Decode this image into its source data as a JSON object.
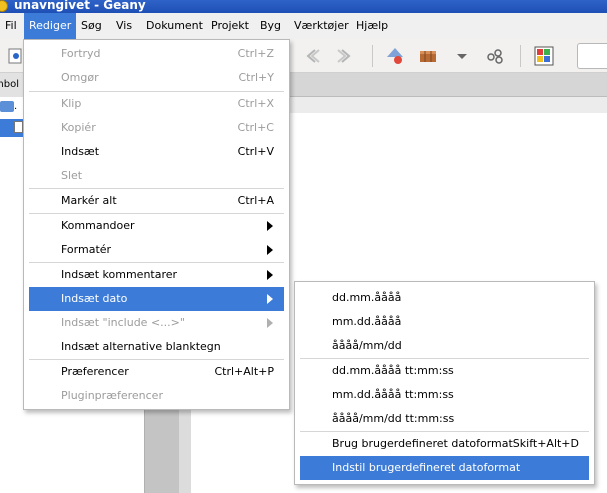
{
  "window": {
    "title": "unavngivet - Geany"
  },
  "menubar": [
    "Fil",
    "Rediger",
    "Søg",
    "Vis",
    "Dokument",
    "Projekt",
    "Byg",
    "Værktøjer",
    "Hjælp"
  ],
  "sidebar": {
    "tab_label": "mbol",
    "tree_label": "."
  },
  "colors": {
    "selection": "#3c7cd8",
    "disabled_text": "#9c9c9c",
    "titlebar": "#1e4fb5"
  },
  "rediger_menu": {
    "items": [
      {
        "label": "Fortryd",
        "accel": "Ctrl+Z",
        "disabled": true
      },
      {
        "label": "Omgør",
        "accel": "Ctrl+Y",
        "disabled": true
      },
      {
        "label": "Klip",
        "accel": "Ctrl+X",
        "disabled": true
      },
      {
        "label": "Kopiér",
        "accel": "Ctrl+C",
        "disabled": true
      },
      {
        "label": "Indsæt",
        "accel": "Ctrl+V",
        "disabled": false
      },
      {
        "label": "Slet",
        "accel": "",
        "disabled": true
      },
      {
        "label": "Markér alt",
        "accel": "Ctrl+A",
        "disabled": false
      },
      {
        "label": "Kommandoer",
        "accel": "",
        "disabled": false,
        "submenu": true
      },
      {
        "label": "Formatér",
        "accel": "",
        "disabled": false,
        "submenu": true
      },
      {
        "label": "Indsæt kommentarer",
        "accel": "",
        "disabled": false,
        "submenu": true
      },
      {
        "label": "Indsæt dato",
        "accel": "",
        "disabled": false,
        "submenu": true,
        "selected": true
      },
      {
        "label": "Indsæt \"include <...>\"",
        "accel": "",
        "disabled": true,
        "submenu": true
      },
      {
        "label": "Indsæt alternative blanktegn",
        "accel": "",
        "disabled": false
      },
      {
        "label": "Præferencer",
        "accel": "Ctrl+Alt+P",
        "disabled": false
      },
      {
        "label": "Pluginpræferencer",
        "accel": "",
        "disabled": true
      }
    ]
  },
  "dato_menu": {
    "items": [
      {
        "label": "dd.mm.åååå",
        "accel": ""
      },
      {
        "label": "mm.dd.åååå",
        "accel": ""
      },
      {
        "label": "åååå/mm/dd",
        "accel": ""
      },
      {
        "label": "dd.mm.åååå tt:mm:ss",
        "accel": ""
      },
      {
        "label": "mm.dd.åååå tt:mm:ss",
        "accel": ""
      },
      {
        "label": "åååå/mm/dd tt:mm:ss",
        "accel": ""
      },
      {
        "label": "Brug brugerdefineret datoformat",
        "accel": "Skift+Alt+D"
      },
      {
        "label": "Indstil brugerdefineret datoformat",
        "accel": "",
        "selected": true
      }
    ]
  }
}
